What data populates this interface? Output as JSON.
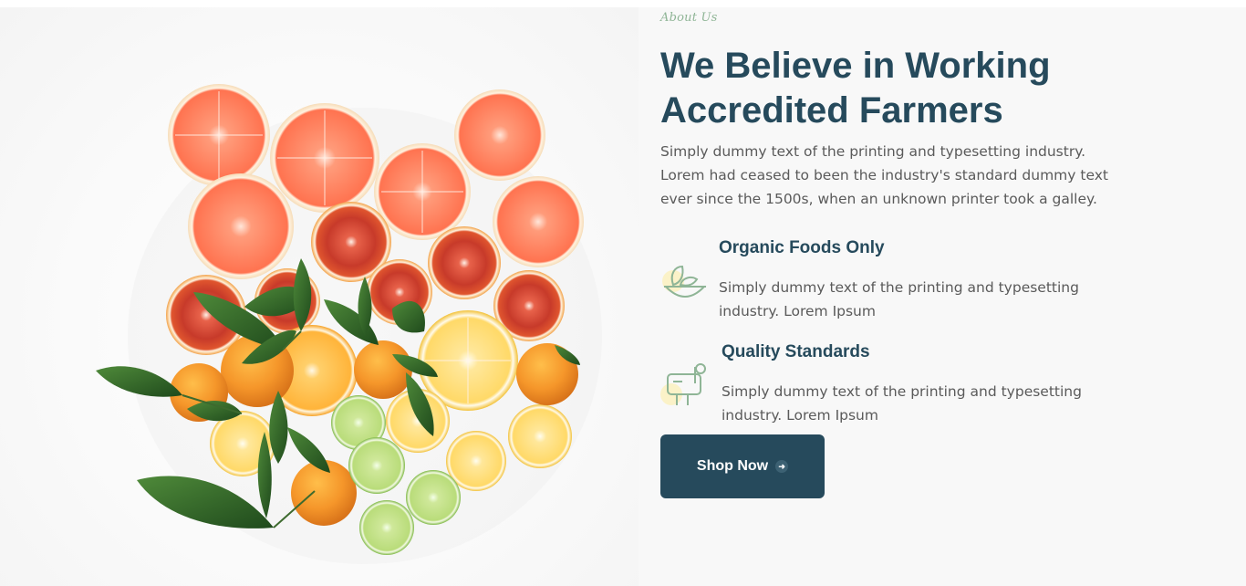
{
  "about": {
    "eyebrow": "About Us",
    "title_line1": "We Believe in Working",
    "title_line2": "Accredited Farmers",
    "intro": "Simply dummy text of the printing and typesetting industry. Lorem had ceased to been the industry's standard dummy text ever since the 1500s, when an unknown printer took a galley."
  },
  "features": [
    {
      "title": "Organic Foods Only",
      "text": "Simply dummy text of the printing and typesetting industry. Lorem Ipsum",
      "icon": "bowl-leaf-icon"
    },
    {
      "title": "Quality Standards",
      "text": "Simply dummy text of the printing and typesetting industry. Lorem Ipsum",
      "icon": "mailbox-icon"
    }
  ],
  "cta": {
    "label": "Shop Now",
    "icon": "arrow-right-icon"
  },
  "colors": {
    "brand_dark": "#264a5c",
    "accent_green": "#8fb596",
    "body_text": "#5a5a5a",
    "icon_highlight": "#fbf2c8"
  },
  "image": {
    "subject": "citrus-fruits-photo"
  }
}
